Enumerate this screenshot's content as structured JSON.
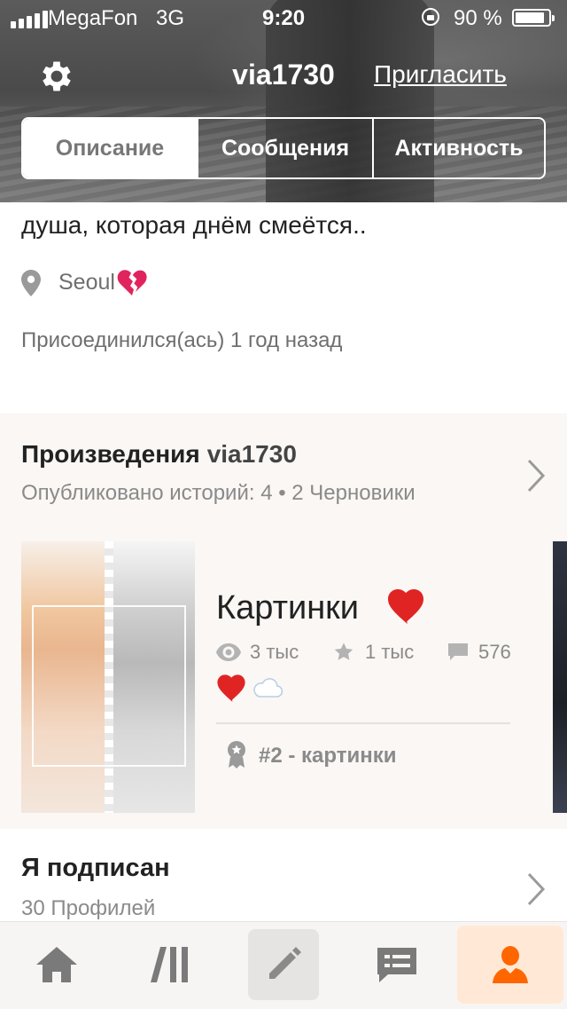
{
  "status_bar": {
    "carrier": "MegaFon",
    "network": "3G",
    "time": "9:20",
    "battery_percent": "90 %",
    "battery_level": 0.9
  },
  "header": {
    "username": "via1730",
    "invite_label": "Пригласить",
    "settings_icon": "gear-icon"
  },
  "tabs": [
    {
      "label": "Описание",
      "active": true
    },
    {
      "label": "Сообщения",
      "active": false
    },
    {
      "label": "Активность",
      "active": false
    }
  ],
  "profile": {
    "bio_visible_line": "душа, которая днём смеётся..",
    "location": "Seoul",
    "location_emoji": "broken-heart",
    "joined": "Присоединился(ась) 1 год назад"
  },
  "works": {
    "title": "Произведения",
    "username": "via1730",
    "subtitle": "Опубликовано историй: 4 • 2 Черновики",
    "story": {
      "title": "Картинки",
      "title_emoji": "red-heart",
      "views": "3 тыс",
      "votes": "1 тыс",
      "comments": "576",
      "description_emoji": [
        "red-heart",
        "cloud"
      ],
      "rank": "#2 - картинки"
    }
  },
  "following": {
    "title": "Я подписан",
    "subtitle": "30 Профилей"
  },
  "bottom_nav": [
    {
      "icon": "home-icon"
    },
    {
      "icon": "library-icon"
    },
    {
      "icon": "pencil-icon"
    },
    {
      "icon": "messages-icon"
    },
    {
      "icon": "profile-icon",
      "active": true
    }
  ],
  "colors": {
    "accent": "#ff6600",
    "muted_text": "#8a8a8a",
    "works_bg": "#faf7f4",
    "nav_active_bg": "#ffe9d6"
  }
}
